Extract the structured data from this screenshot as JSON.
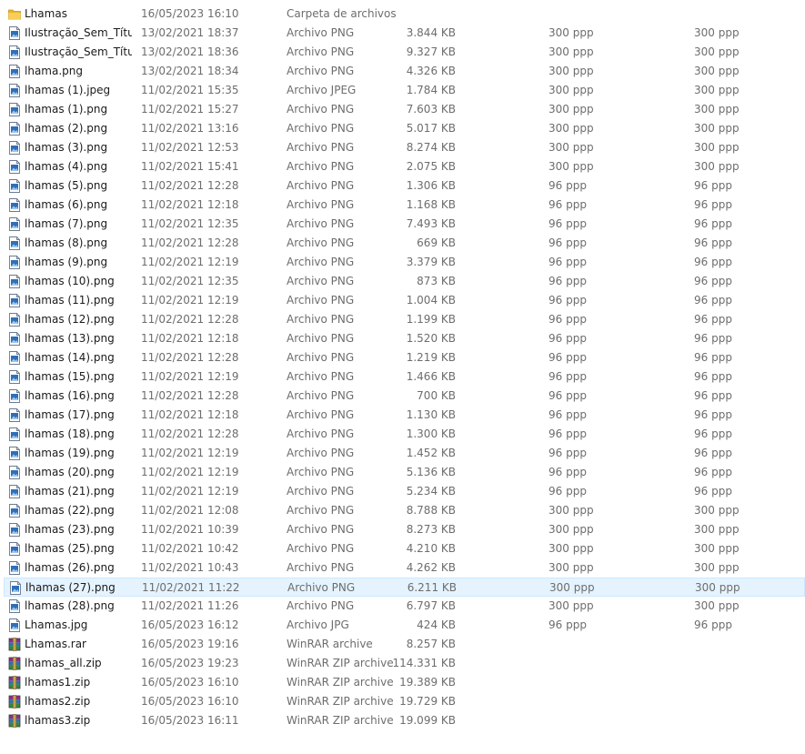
{
  "explorer": {
    "files": [
      {
        "name": "Lhamas",
        "date": "16/05/2023 16:10",
        "type": "Carpeta de archivos",
        "size": "",
        "hres": "",
        "vres": "",
        "icon": "folder-icon"
      },
      {
        "name": "Ilustração_Sem_Títu...",
        "date": "13/02/2021 18:37",
        "type": "Archivo PNG",
        "size": "3.844 KB",
        "hres": "300 ppp",
        "vres": "300 ppp",
        "icon": "image-file-icon"
      },
      {
        "name": "Ilustração_Sem_Títu...",
        "date": "13/02/2021 18:36",
        "type": "Archivo PNG",
        "size": "9.327 KB",
        "hres": "300 ppp",
        "vres": "300 ppp",
        "icon": "image-file-icon"
      },
      {
        "name": "lhama.png",
        "date": "13/02/2021 18:34",
        "type": "Archivo PNG",
        "size": "4.326 KB",
        "hres": "300 ppp",
        "vres": "300 ppp",
        "icon": "image-file-icon"
      },
      {
        "name": "lhamas (1).jpeg",
        "date": "11/02/2021 15:35",
        "type": "Archivo JPEG",
        "size": "1.784 KB",
        "hres": "300 ppp",
        "vres": "300 ppp",
        "icon": "image-file-icon"
      },
      {
        "name": "lhamas (1).png",
        "date": "11/02/2021 15:27",
        "type": "Archivo PNG",
        "size": "7.603 KB",
        "hres": "300 ppp",
        "vres": "300 ppp",
        "icon": "image-file-icon"
      },
      {
        "name": "lhamas (2).png",
        "date": "11/02/2021 13:16",
        "type": "Archivo PNG",
        "size": "5.017 KB",
        "hres": "300 ppp",
        "vres": "300 ppp",
        "icon": "image-file-icon"
      },
      {
        "name": "lhamas (3).png",
        "date": "11/02/2021 12:53",
        "type": "Archivo PNG",
        "size": "8.274 KB",
        "hres": "300 ppp",
        "vres": "300 ppp",
        "icon": "image-file-icon"
      },
      {
        "name": "lhamas (4).png",
        "date": "11/02/2021 15:41",
        "type": "Archivo PNG",
        "size": "2.075 KB",
        "hres": "300 ppp",
        "vres": "300 ppp",
        "icon": "image-file-icon"
      },
      {
        "name": "lhamas (5).png",
        "date": "11/02/2021 12:28",
        "type": "Archivo PNG",
        "size": "1.306 KB",
        "hres": "96 ppp",
        "vres": "96 ppp",
        "icon": "image-file-icon"
      },
      {
        "name": "lhamas (6).png",
        "date": "11/02/2021 12:18",
        "type": "Archivo PNG",
        "size": "1.168 KB",
        "hres": "96 ppp",
        "vres": "96 ppp",
        "icon": "image-file-icon"
      },
      {
        "name": "lhamas (7).png",
        "date": "11/02/2021 12:35",
        "type": "Archivo PNG",
        "size": "7.493 KB",
        "hres": "96 ppp",
        "vres": "96 ppp",
        "icon": "image-file-icon"
      },
      {
        "name": "lhamas (8).png",
        "date": "11/02/2021 12:28",
        "type": "Archivo PNG",
        "size": "669 KB",
        "hres": "96 ppp",
        "vres": "96 ppp",
        "icon": "image-file-icon"
      },
      {
        "name": "lhamas (9).png",
        "date": "11/02/2021 12:19",
        "type": "Archivo PNG",
        "size": "3.379 KB",
        "hres": "96 ppp",
        "vres": "96 ppp",
        "icon": "image-file-icon"
      },
      {
        "name": "lhamas (10).png",
        "date": "11/02/2021 12:35",
        "type": "Archivo PNG",
        "size": "873 KB",
        "hres": "96 ppp",
        "vres": "96 ppp",
        "icon": "image-file-icon"
      },
      {
        "name": "lhamas (11).png",
        "date": "11/02/2021 12:19",
        "type": "Archivo PNG",
        "size": "1.004 KB",
        "hres": "96 ppp",
        "vres": "96 ppp",
        "icon": "image-file-icon"
      },
      {
        "name": "lhamas (12).png",
        "date": "11/02/2021 12:28",
        "type": "Archivo PNG",
        "size": "1.199 KB",
        "hres": "96 ppp",
        "vres": "96 ppp",
        "icon": "image-file-icon"
      },
      {
        "name": "lhamas (13).png",
        "date": "11/02/2021 12:18",
        "type": "Archivo PNG",
        "size": "1.520 KB",
        "hres": "96 ppp",
        "vres": "96 ppp",
        "icon": "image-file-icon"
      },
      {
        "name": "lhamas (14).png",
        "date": "11/02/2021 12:28",
        "type": "Archivo PNG",
        "size": "1.219 KB",
        "hres": "96 ppp",
        "vres": "96 ppp",
        "icon": "image-file-icon"
      },
      {
        "name": "lhamas (15).png",
        "date": "11/02/2021 12:19",
        "type": "Archivo PNG",
        "size": "1.466 KB",
        "hres": "96 ppp",
        "vres": "96 ppp",
        "icon": "image-file-icon"
      },
      {
        "name": "lhamas (16).png",
        "date": "11/02/2021 12:28",
        "type": "Archivo PNG",
        "size": "700 KB",
        "hres": "96 ppp",
        "vres": "96 ppp",
        "icon": "image-file-icon"
      },
      {
        "name": "lhamas (17).png",
        "date": "11/02/2021 12:18",
        "type": "Archivo PNG",
        "size": "1.130 KB",
        "hres": "96 ppp",
        "vres": "96 ppp",
        "icon": "image-file-icon"
      },
      {
        "name": "lhamas (18).png",
        "date": "11/02/2021 12:28",
        "type": "Archivo PNG",
        "size": "1.300 KB",
        "hres": "96 ppp",
        "vres": "96 ppp",
        "icon": "image-file-icon"
      },
      {
        "name": "lhamas (19).png",
        "date": "11/02/2021 12:19",
        "type": "Archivo PNG",
        "size": "1.452 KB",
        "hres": "96 ppp",
        "vres": "96 ppp",
        "icon": "image-file-icon"
      },
      {
        "name": "lhamas (20).png",
        "date": "11/02/2021 12:19",
        "type": "Archivo PNG",
        "size": "5.136 KB",
        "hres": "96 ppp",
        "vres": "96 ppp",
        "icon": "image-file-icon"
      },
      {
        "name": "lhamas (21).png",
        "date": "11/02/2021 12:19",
        "type": "Archivo PNG",
        "size": "5.234 KB",
        "hres": "96 ppp",
        "vres": "96 ppp",
        "icon": "image-file-icon"
      },
      {
        "name": "lhamas (22).png",
        "date": "11/02/2021 12:08",
        "type": "Archivo PNG",
        "size": "8.788 KB",
        "hres": "300 ppp",
        "vres": "300 ppp",
        "icon": "image-file-icon"
      },
      {
        "name": "lhamas (23).png",
        "date": "11/02/2021 10:39",
        "type": "Archivo PNG",
        "size": "8.273 KB",
        "hres": "300 ppp",
        "vres": "300 ppp",
        "icon": "image-file-icon"
      },
      {
        "name": "lhamas (25).png",
        "date": "11/02/2021 10:42",
        "type": "Archivo PNG",
        "size": "4.210 KB",
        "hres": "300 ppp",
        "vres": "300 ppp",
        "icon": "image-file-icon"
      },
      {
        "name": "lhamas (26).png",
        "date": "11/02/2021 10:43",
        "type": "Archivo PNG",
        "size": "4.262 KB",
        "hres": "300 ppp",
        "vres": "300 ppp",
        "icon": "image-file-icon"
      },
      {
        "name": "lhamas (27).png",
        "date": "11/02/2021 11:22",
        "type": "Archivo PNG",
        "size": "6.211 KB",
        "hres": "300 ppp",
        "vres": "300 ppp",
        "icon": "image-file-icon",
        "selected": true
      },
      {
        "name": "lhamas (28).png",
        "date": "11/02/2021 11:26",
        "type": "Archivo PNG",
        "size": "6.797 KB",
        "hres": "300 ppp",
        "vres": "300 ppp",
        "icon": "image-file-icon"
      },
      {
        "name": "Lhamas.jpg",
        "date": "16/05/2023 16:12",
        "type": "Archivo JPG",
        "size": "424 KB",
        "hres": "96 ppp",
        "vres": "96 ppp",
        "icon": "image-file-icon"
      },
      {
        "name": "Lhamas.rar",
        "date": "16/05/2023 19:16",
        "type": "WinRAR archive",
        "size": "8.257 KB",
        "hres": "",
        "vres": "",
        "icon": "winrar-archive-icon"
      },
      {
        "name": "lhamas_all.zip",
        "date": "16/05/2023 19:23",
        "type": "WinRAR ZIP archive",
        "size": "114.331 KB",
        "hres": "",
        "vres": "",
        "icon": "winrar-archive-icon"
      },
      {
        "name": "lhamas1.zip",
        "date": "16/05/2023 16:10",
        "type": "WinRAR ZIP archive",
        "size": "19.389 KB",
        "hres": "",
        "vres": "",
        "icon": "winrar-archive-icon"
      },
      {
        "name": "lhamas2.zip",
        "date": "16/05/2023 16:10",
        "type": "WinRAR ZIP archive",
        "size": "19.729 KB",
        "hres": "",
        "vres": "",
        "icon": "winrar-archive-icon"
      },
      {
        "name": "lhamas3.zip",
        "date": "16/05/2023 16:11",
        "type": "WinRAR ZIP archive",
        "size": "19.099 KB",
        "hres": "",
        "vres": "",
        "icon": "winrar-archive-icon"
      }
    ]
  },
  "colors": {
    "selected_bg": "#e5f3ff",
    "folder": "#f5c542",
    "secondary_text": "#6d6d6d"
  }
}
